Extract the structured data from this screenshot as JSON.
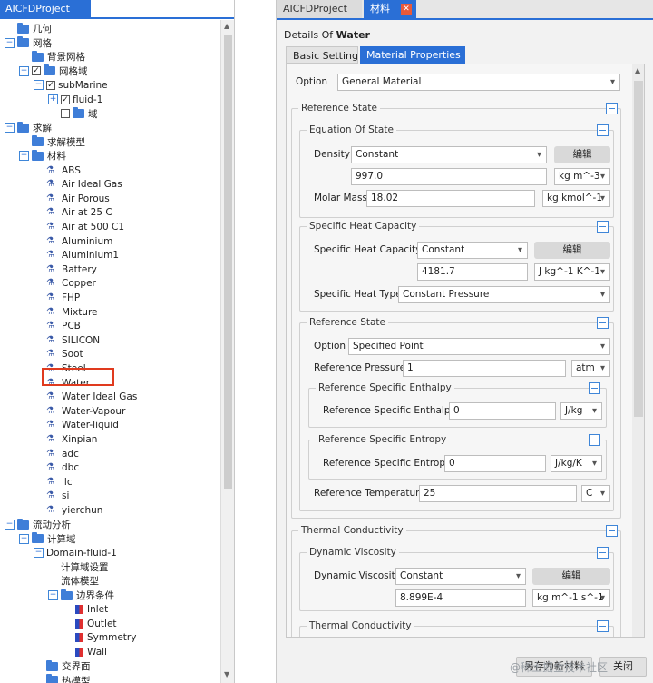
{
  "left_panel": {
    "tab_title": "AICFDProject",
    "tree": [
      {
        "label": "几何",
        "indent": 0,
        "expander": null,
        "icon": "folder"
      },
      {
        "label": "网格",
        "indent": 0,
        "expander": "−",
        "icon": "folder"
      },
      {
        "label": "背景网格",
        "indent": 1,
        "expander": null,
        "icon": "folder"
      },
      {
        "label": "网格域",
        "indent": 1,
        "expander": "−",
        "checkbox": "✓",
        "icon": "folder"
      },
      {
        "label": "subMarine",
        "indent": 2,
        "expander": "−",
        "checkbox": "✓",
        "icon": null
      },
      {
        "label": "fluid-1",
        "indent": 3,
        "expander": "+",
        "checkbox": "✓",
        "icon": null
      },
      {
        "label": "域",
        "indent": 3,
        "expander": null,
        "checkbox": "",
        "icon": "folder"
      },
      {
        "label": "求解",
        "indent": 0,
        "expander": "−",
        "icon": "folder"
      },
      {
        "label": "求解模型",
        "indent": 1,
        "expander": null,
        "icon": "folder"
      },
      {
        "label": "材料",
        "indent": 1,
        "expander": "−",
        "icon": "folder"
      },
      {
        "label": "ABS",
        "indent": 2,
        "icon": "material"
      },
      {
        "label": "Air Ideal Gas",
        "indent": 2,
        "icon": "material"
      },
      {
        "label": "Air Porous",
        "indent": 2,
        "icon": "material"
      },
      {
        "label": "Air at 25 C",
        "indent": 2,
        "icon": "material"
      },
      {
        "label": "Air at 500 C1",
        "indent": 2,
        "icon": "material"
      },
      {
        "label": "Aluminium",
        "indent": 2,
        "icon": "material"
      },
      {
        "label": "Aluminium1",
        "indent": 2,
        "icon": "material"
      },
      {
        "label": "Battery",
        "indent": 2,
        "icon": "material"
      },
      {
        "label": "Copper",
        "indent": 2,
        "icon": "material"
      },
      {
        "label": "FHP",
        "indent": 2,
        "icon": "material"
      },
      {
        "label": "Mixture",
        "indent": 2,
        "icon": "material"
      },
      {
        "label": "PCB",
        "indent": 2,
        "icon": "material"
      },
      {
        "label": "SILICON",
        "indent": 2,
        "icon": "material"
      },
      {
        "label": "Soot",
        "indent": 2,
        "icon": "material"
      },
      {
        "label": "Steel",
        "indent": 2,
        "icon": "material"
      },
      {
        "label": "Water",
        "indent": 2,
        "icon": "material",
        "selected": true
      },
      {
        "label": "Water Ideal Gas",
        "indent": 2,
        "icon": "material"
      },
      {
        "label": "Water-Vapour",
        "indent": 2,
        "icon": "material"
      },
      {
        "label": "Water-liquid",
        "indent": 2,
        "icon": "material"
      },
      {
        "label": "Xinpian",
        "indent": 2,
        "icon": "material"
      },
      {
        "label": "adc",
        "indent": 2,
        "icon": "material"
      },
      {
        "label": "dbc",
        "indent": 2,
        "icon": "material"
      },
      {
        "label": "llc",
        "indent": 2,
        "icon": "material"
      },
      {
        "label": "si",
        "indent": 2,
        "icon": "material"
      },
      {
        "label": "yierchun",
        "indent": 2,
        "icon": "material"
      },
      {
        "label": "流动分析",
        "indent": 0,
        "expander": "−",
        "icon": "folder"
      },
      {
        "label": "计算域",
        "indent": 1,
        "expander": "−",
        "icon": "folder"
      },
      {
        "label": "Domain-fluid-1",
        "indent": 2,
        "expander": "−",
        "icon": null
      },
      {
        "label": "计算域设置",
        "indent": 3,
        "icon": null
      },
      {
        "label": "流体模型",
        "indent": 3,
        "icon": null
      },
      {
        "label": "边界条件",
        "indent": 3,
        "expander": "−",
        "icon": "folder"
      },
      {
        "label": "Inlet",
        "indent": 4,
        "icon": "boundary"
      },
      {
        "label": "Outlet",
        "indent": 4,
        "icon": "boundary"
      },
      {
        "label": "Symmetry",
        "indent": 4,
        "icon": "boundary"
      },
      {
        "label": "Wall",
        "indent": 4,
        "icon": "boundary"
      },
      {
        "label": "交界面",
        "indent": 2,
        "icon": "folder"
      },
      {
        "label": "热模型",
        "indent": 2,
        "icon": "folder"
      }
    ]
  },
  "right_panel": {
    "tabs": [
      {
        "label": "AICFDProject"
      },
      {
        "label": "材料",
        "close": "✕"
      }
    ],
    "details_prefix": "Details Of ",
    "details_name": "Water",
    "subtabs": [
      "Basic Setting",
      "Material Properties"
    ],
    "option": {
      "label": "Option",
      "value": "General Material"
    },
    "reference_state": {
      "title": "Reference State",
      "equation_of_state": {
        "title": "Equation Of State",
        "density_label": "Density",
        "density_mode": "Constant",
        "density_button": "编辑",
        "density_value": "997.0",
        "density_unit": "kg m^-3",
        "molar_mass_label": "Molar Mass",
        "molar_mass_value": "18.02",
        "molar_mass_unit": "kg kmol^-1"
      },
      "specific_heat": {
        "title": "Specific Heat Capacity",
        "label": "Specific Heat Capacity",
        "mode": "Constant",
        "button": "编辑",
        "value": "4181.7",
        "unit": "J kg^-1 K^-1",
        "type_label": "Specific Heat Type",
        "type_value": "Constant Pressure"
      },
      "inner_reference_state": {
        "title": "Reference State",
        "option_label": "Option",
        "option_value": "Specified Point",
        "pressure_label": "Reference Pressure",
        "pressure_value": "1",
        "pressure_unit": "atm",
        "enthalpy_title": "Reference Specific Enthalpy",
        "enthalpy_label": "Reference Specific Enthalpy",
        "enthalpy_value": "0",
        "enthalpy_unit": "J/kg",
        "entropy_title": "Reference Specific Entropy",
        "entropy_label": "Reference Specific Entropy",
        "entropy_value": "0",
        "entropy_unit": "J/kg/K",
        "temperature_label": "Reference Temperature",
        "temperature_value": "25",
        "temperature_unit": "C"
      }
    },
    "thermal_conductivity": {
      "title": "Thermal Conductivity",
      "dynamic_viscosity": {
        "title": "Dynamic Viscosity",
        "label": "Dynamic Viscosity",
        "mode": "Constant",
        "button": "编辑",
        "value": "8.899E-4",
        "unit": "kg m^-1 s^-1"
      },
      "inner_title": "Thermal Conductivity"
    },
    "buttons": {
      "save_as": "另存为新材料",
      "close": "关闭"
    },
    "watermark": "@稀土掘金技术社区"
  },
  "colors": {
    "accent": "#2a6fd6",
    "highlight": "#e03a1e"
  }
}
